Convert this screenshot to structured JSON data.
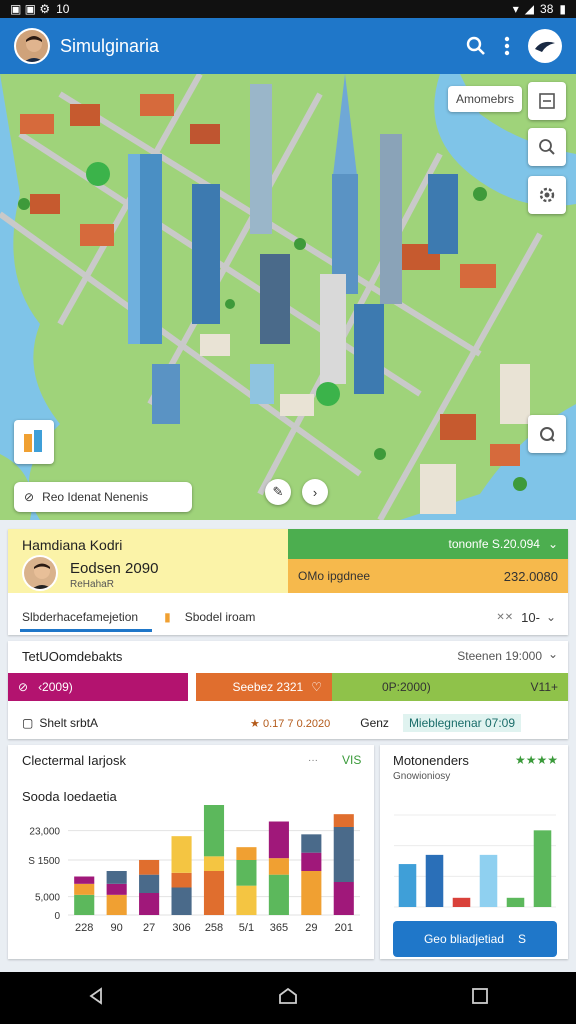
{
  "status_bar": {
    "time": "10",
    "battery": "38"
  },
  "app_bar": {
    "title": "Simulginaria"
  },
  "map": {
    "overlay_chip": "Amomebrs",
    "search_label": "Reo Idenat Nenenis"
  },
  "profile_card": {
    "name": "Hamdiana Kodri",
    "score": "Eodsen 2090",
    "subtext": "ReHahaR",
    "green_stat": "tononfe S.20.094",
    "orange_left": "OMo ipgdnee",
    "orange_right": "232.0080",
    "tab_active": "Slbderhacefamejetion",
    "tab_second": "Sbodel iroam",
    "tab_count": "10-"
  },
  "stats_card": {
    "title": "TetUOomdebakts",
    "top_right": "Steenen 19:000",
    "seg_magenta": "‹2009)",
    "seg_orange": "Seebez 2321",
    "seg_green": "0P:2000)",
    "seg_green_right": "V11+",
    "row_left": "Shelt srbtA",
    "row_mid": "★ 0.17 7 0.2020",
    "row_gen": "Genz",
    "row_right": "Mieblegnenar 07:09"
  },
  "chart_card": {
    "title": "Clectermal Iarjosk",
    "badge": "VIS",
    "subtitle": "Sooda  Ioedaetia",
    "y_ticks": [
      "23,000",
      "S 1500",
      "5,000",
      "0"
    ],
    "x_ticks": [
      "228",
      "90",
      "27",
      "306",
      "258",
      "5/1",
      "365",
      "29",
      "201"
    ]
  },
  "chart_data": {
    "type": "bar",
    "title": "Clectermal Iarjosk",
    "subtitle": "Sooda  Ioedaetia",
    "categories": [
      "228",
      "90",
      "27",
      "306",
      "258",
      "5/1",
      "365",
      "29",
      "201"
    ],
    "ylim": [
      0,
      30000
    ],
    "series": [
      {
        "values": [
          5500,
          5500,
          6000,
          7500,
          12000,
          8000,
          11000,
          12000,
          9000
        ]
      },
      {
        "values": [
          3000,
          3000,
          5000,
          4000,
          4000,
          7000,
          4500,
          5000,
          15000
        ]
      },
      {
        "values": [
          2000,
          3500,
          4000,
          10000,
          14000,
          3500,
          10000,
          5000,
          3500
        ]
      }
    ],
    "colors": [
      "#5cb85c",
      "#f0a032",
      "#a0187a",
      "#4a6a8a",
      "#e06e2e",
      "#f4c542"
    ]
  },
  "small_chart_card": {
    "title": "Motonenders",
    "subtitle": "Gnowioniosy",
    "rating": "★★★★",
    "button_label": "Geo bliadjetiad",
    "button_value": "S"
  },
  "small_chart_data": {
    "type": "bar",
    "values": [
      28,
      34,
      6,
      34,
      6,
      50
    ],
    "colors": [
      "#3f9fd8",
      "#2a6fb8",
      "#d9413a",
      "#8fd0f0",
      "#5cb85c",
      "#5cb85c"
    ]
  },
  "colors": {
    "brand": "#1f77c9",
    "green": "#4cae4f",
    "orange": "#f6b94c",
    "magenta": "#b3136f"
  }
}
